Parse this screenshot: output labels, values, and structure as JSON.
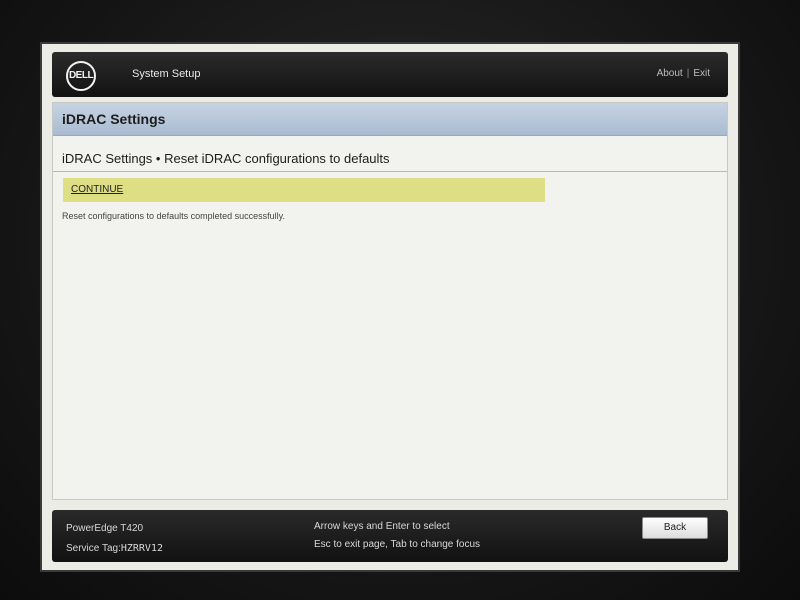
{
  "header": {
    "logo_text": "DELL",
    "app_title": "System Setup",
    "links": [
      "About",
      "Exit"
    ]
  },
  "section": {
    "title": "iDRAC Settings",
    "subtitle": "iDRAC Settings • Reset iDRAC configurations to defaults"
  },
  "content": {
    "continue_label": "CONTINUE",
    "status_message": "Reset configurations to defaults completed successfully."
  },
  "footer": {
    "model": "PowerEdge T420",
    "service_tag_label": "Service Tag:",
    "service_tag_value": "HZRRV12",
    "hint_line1": "Arrow keys and Enter to select",
    "hint_line2": "Esc to exit page, Tab to change focus",
    "back_label": "Back"
  },
  "colors": {
    "highlight": "#dede84",
    "section_bar": "#b8c7da"
  }
}
